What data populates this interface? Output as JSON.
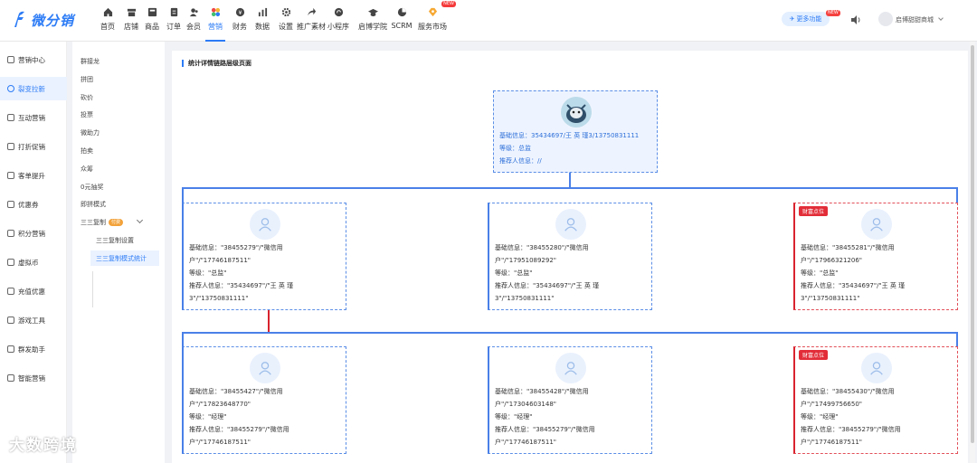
{
  "app": {
    "logo_text": "微分销",
    "brand_color": "#2d7cf6"
  },
  "nav": [
    {
      "label": "首页",
      "icon": "home-icon"
    },
    {
      "label": "店铺",
      "icon": "store-icon"
    },
    {
      "label": "商品",
      "icon": "goods-icon"
    },
    {
      "label": "订单",
      "icon": "order-icon"
    },
    {
      "label": "会员",
      "icon": "member-icon"
    },
    {
      "label": "营销",
      "icon": "marketing-icon",
      "active": true
    },
    {
      "label": "财务",
      "icon": "finance-icon"
    },
    {
      "label": "数据",
      "icon": "data-icon"
    },
    {
      "label": "设置",
      "icon": "settings-icon"
    },
    {
      "label": "推广素材",
      "icon": "share-icon"
    },
    {
      "label": "小程序",
      "icon": "miniprogram-icon"
    },
    {
      "label": "启博学院",
      "icon": "academy-icon"
    },
    {
      "label": "SCRM",
      "icon": "scrm-icon"
    },
    {
      "label": "服务市场",
      "icon": "market-icon",
      "badge": "NEW"
    }
  ],
  "header": {
    "more_label": "更多功能",
    "more_badge": "NEW",
    "shop_name": "启博甜甜商城"
  },
  "sidebar": [
    {
      "label": "营销中心"
    },
    {
      "label": "裂变拉新",
      "active": true
    },
    {
      "label": "互动营销"
    },
    {
      "label": "打折促销"
    },
    {
      "label": "客单提升"
    },
    {
      "label": "优惠券"
    },
    {
      "label": "积分营销"
    },
    {
      "label": "虚拟币"
    },
    {
      "label": "充值优惠"
    },
    {
      "label": "游戏工具"
    },
    {
      "label": "群发助手"
    },
    {
      "label": "智能营销"
    }
  ],
  "subsidebar": {
    "items": [
      "群接龙",
      "拼团",
      "砍价",
      "投票",
      "微助力",
      "拍卖",
      "众筹",
      "0元抽奖",
      "即拼模式"
    ],
    "group": {
      "label": "三三复制",
      "badge": "付费"
    },
    "children": [
      {
        "label": "三三复制设置"
      },
      {
        "label": "三三复制模式统计",
        "active": true
      }
    ]
  },
  "main": {
    "title": "统计详情链路层级页面",
    "root": {
      "line1": "基础信息：35434697/王 英 瑾3/13750831111",
      "line2": "等级：总监",
      "line3": "推荐人信息：//"
    },
    "rich_tag": "财富点位",
    "level1": [
      {
        "lines": [
          "基础信息：\"38455279\"/\"微信用",
          "户\"/\"17746187511\"",
          "等级：\"总监\"",
          "推荐人信息：\"35434697\"/\"王 英 瑾",
          "3\"/\"13750831111\""
        ],
        "rich": false
      },
      {
        "lines": [
          "基础信息：\"38455280\"/\"微信用",
          "户\"/\"17951089292\"",
          "等级：\"总监\"",
          "推荐人信息：\"35434697\"/\"王 英 瑾",
          "3\"/\"13750831111\""
        ],
        "rich": false
      },
      {
        "lines": [
          "基础信息：\"38455281\"/\"微信用",
          "户\"/\"17966321206\"",
          "等级：\"总监\"",
          "推荐人信息：\"35434697\"/\"王 英 瑾",
          "3\"/\"13750831111\""
        ],
        "rich": true
      }
    ],
    "level2": [
      {
        "lines": [
          "基础信息：\"38455427\"/\"微信用",
          "户\"/\"17823648770\"",
          "等级：\"经理\"",
          "推荐人信息：\"38455279\"/\"微信用",
          "户\"/\"17746187511\""
        ],
        "rich": false
      },
      {
        "lines": [
          "基础信息：\"38455428\"/\"微信用",
          "户\"/\"17304603148\"",
          "等级：\"经理\"",
          "推荐人信息：\"38455279\"/\"微信用",
          "户\"/\"17746187511\""
        ],
        "rich": false
      },
      {
        "lines": [
          "基础信息：\"38455430\"/\"微信用",
          "户\"/\"17499756650\"",
          "等级：\"经理\"",
          "推荐人信息：\"38455279\"/\"微信用",
          "户\"/\"17746187511\""
        ],
        "rich": true
      }
    ]
  },
  "watermark": "大数跨境"
}
